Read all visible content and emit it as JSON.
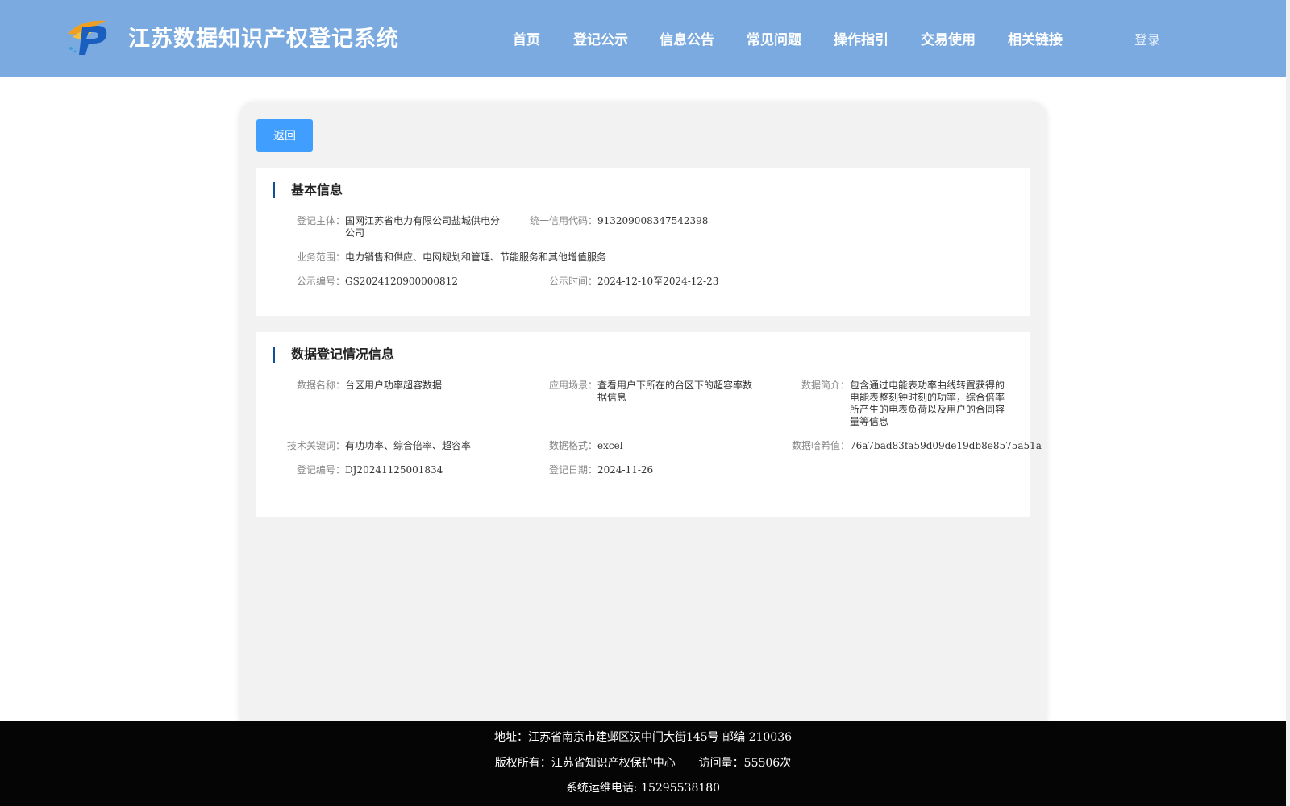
{
  "header": {
    "title": "江苏数据知识产权登记系统",
    "logo_icon": "ip-logo-icon",
    "nav": [
      "首页",
      "登记公示",
      "信息公告",
      "常见问题",
      "操作指引",
      "交易使用",
      "相关链接"
    ],
    "login": "登录"
  },
  "card": {
    "back_label": "返回",
    "basic": {
      "title": "基本信息",
      "subject_label": "登记主体：",
      "subject_value": "国网江苏省电力有限公司盐城供电分公司",
      "credit_label": "统一信用代码：",
      "credit_value": "913209008347542398",
      "scope_label": "业务范围：",
      "scope_value": "电力销售和供应、电网规划和管理、节能服务和其他增值服务",
      "pub_no_label": "公示编号：",
      "pub_no_value": "GS2024120900000812",
      "pub_time_label": "公示时间：",
      "pub_time_value": "2024-12-10至2024-12-23"
    },
    "data_info": {
      "title": "数据登记情况信息",
      "name_label": "数据名称：",
      "name_value": "台区用户功率超容数据",
      "scene_label": "应用场景：",
      "scene_value": "查看用户下所在的台区下的超容率数据信息",
      "brief_label": "数据简介：",
      "brief_value": "包含通过电能表功率曲线转置获得的电能表整刻钟时刻的功率，综合倍率所产生的电表负荷以及用户的合同容量等信息",
      "keyword_label": "技术关键词：",
      "keyword_value": "有功功率、综合倍率、超容率",
      "format_label": "数据格式：",
      "format_value": "excel",
      "hash_label": "数据哈希值：",
      "hash_value": "76a7bad83fa59d09de19db8e8575a51a",
      "reg_no_label": "登记编号：",
      "reg_no_value": "DJ20241125001834",
      "reg_date_label": "登记日期：",
      "reg_date_value": "2024-11-26"
    }
  },
  "footer": {
    "address": "地址：江苏省南京市建邺区汉中门大街145号 邮编 210036",
    "copyright": "版权所有：江苏省知识产权保护中心",
    "visits": "访问量：55506次",
    "phone": "系统运维电话: 15295538180"
  },
  "colors": {
    "header_bg": "#7aaae0",
    "button_bg": "#409eff",
    "title_bar": "#0e4f9c",
    "footer_bg": "#050505"
  }
}
